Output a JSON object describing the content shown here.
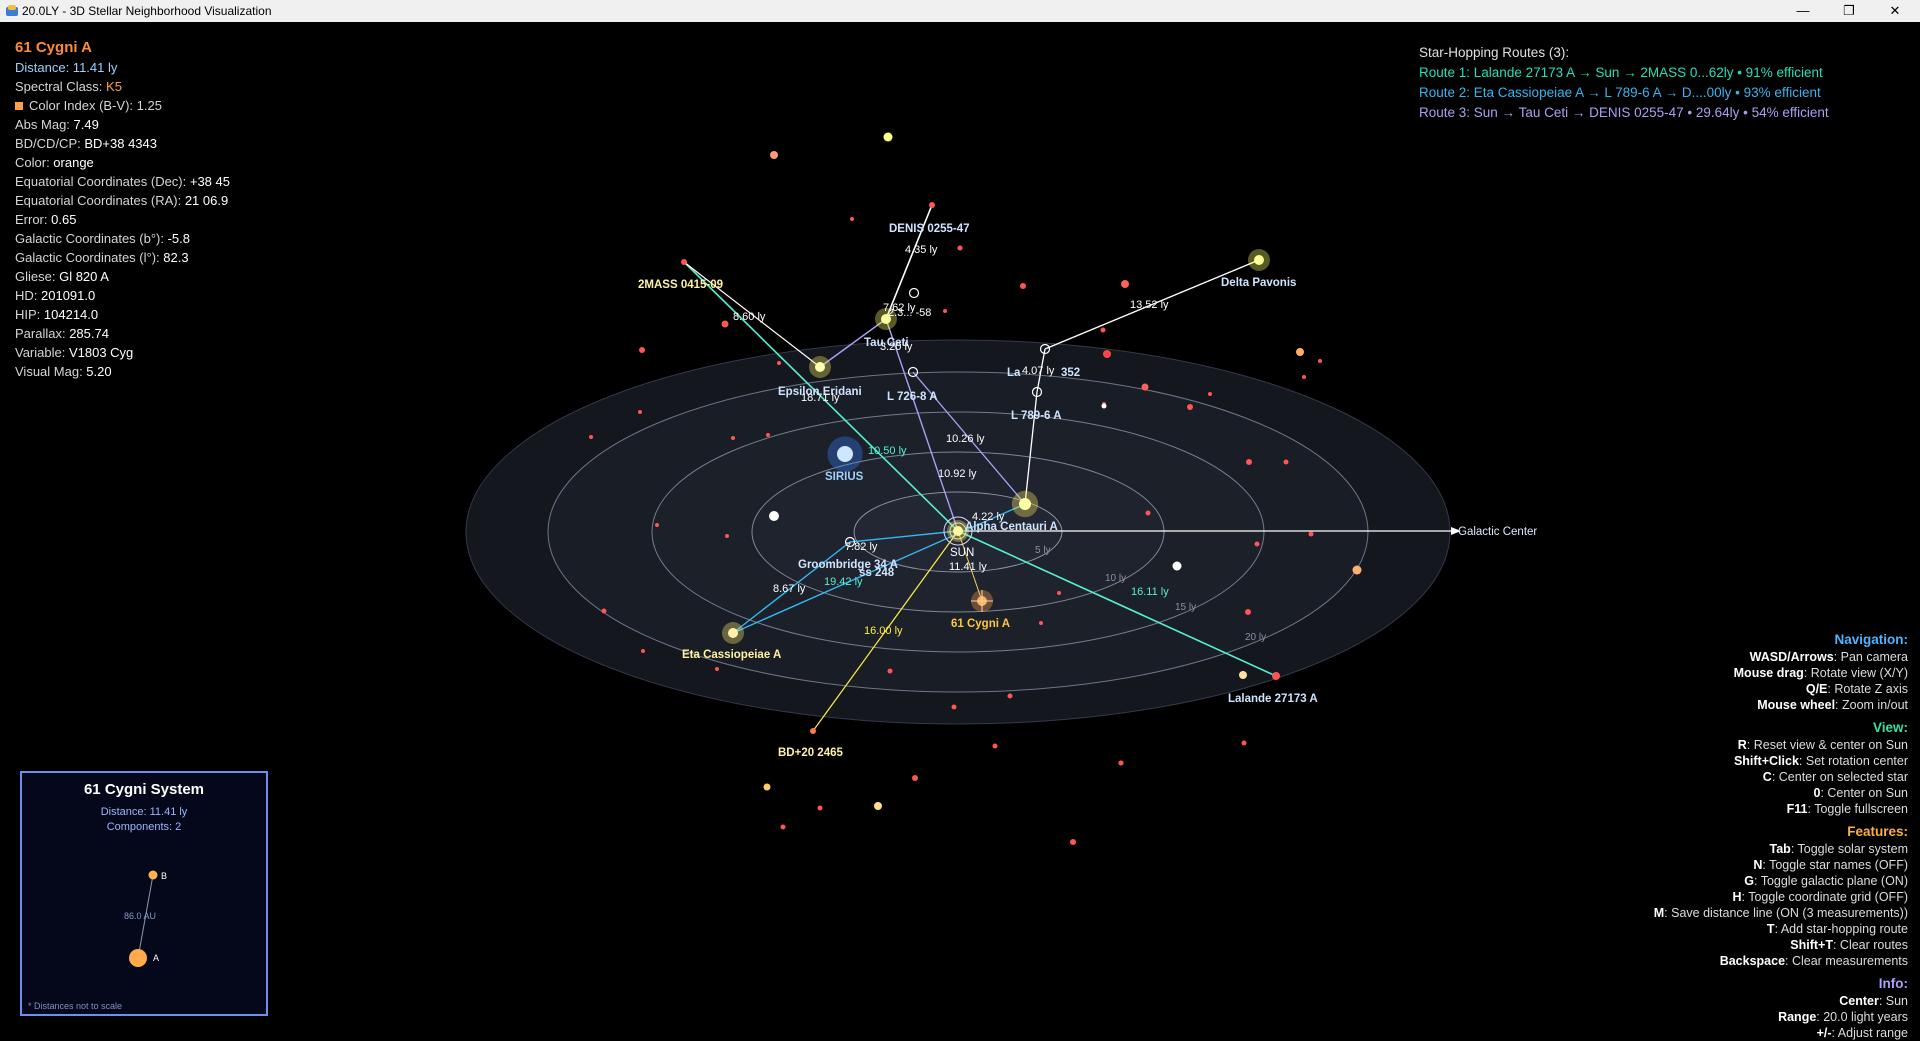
{
  "window": {
    "title": "20.0LY - 3D Stellar Neighborhood Visualization",
    "min_glyph": "—",
    "restore_glyph": "❐",
    "close_glyph": "✕",
    "icon": "app-logo-icon"
  },
  "info": {
    "name": "61 Cygni A",
    "distance": "Distance: 11.41 ly",
    "spectral_label": "Spectral Class: ",
    "spectral_value": "K5",
    "color_index": "Color Index (B-V): 1.25",
    "fields": [
      {
        "label": "Abs Mag: ",
        "value": "7.49"
      },
      {
        "label": "BD/CD/CP: ",
        "value": "BD+38 4343"
      },
      {
        "label": "Color: ",
        "value": "orange"
      },
      {
        "label": "Equatorial Coordinates (Dec): ",
        "value": "+38 45"
      },
      {
        "label": "Equatorial Coordinates (RA): ",
        "value": "21 06.9"
      },
      {
        "label": "Error: ",
        "value": "0.65"
      },
      {
        "label": "Galactic Coordinates (b°): ",
        "value": "-5.8"
      },
      {
        "label": "Galactic Coordinates (l°): ",
        "value": "82.3"
      },
      {
        "label": "Gliese: ",
        "value": "Gl 820 A"
      },
      {
        "label": "HD: ",
        "value": "201091.0"
      },
      {
        "label": "HIP: ",
        "value": "104214.0"
      },
      {
        "label": "Parallax: ",
        "value": "285.74"
      },
      {
        "label": "Variable: ",
        "value": "V1803 Cyg"
      },
      {
        "label": "Visual Mag: ",
        "value": "5.20"
      }
    ]
  },
  "routes": {
    "header": "Star-Hopping Routes (3):",
    "items": [
      {
        "text": "Route 1: Lalande 27173 A → Sun → 2MASS 0...62ly • 91% efficient",
        "color": "#22e0b8"
      },
      {
        "text": "Route 2: Eta Cassiopeiae A → L 789-6 A → D....00ly • 93% efficient",
        "color": "#35b6f0"
      },
      {
        "text": "Route 3: Sun → Tau Ceti → DENIS 0255-47 • 29.64ly • 54% efficient",
        "color": "#a9a0f5"
      }
    ]
  },
  "help": [
    {
      "title": "Navigation:",
      "color": "#4fb3ff",
      "items": [
        {
          "key": "WASD/Arrows",
          "desc": ": Pan camera"
        },
        {
          "key": "Mouse drag",
          "desc": ": Rotate view (X/Y)"
        },
        {
          "key": "Q/E",
          "desc": ": Rotate Z axis"
        },
        {
          "key": "Mouse wheel",
          "desc": ": Zoom in/out"
        }
      ]
    },
    {
      "title": "View:",
      "color": "#3de0a0",
      "items": [
        {
          "key": "R",
          "desc": ": Reset view & center on Sun"
        },
        {
          "key": "Shift+Click",
          "desc": ": Set rotation center"
        },
        {
          "key": "C",
          "desc": ": Center on selected star"
        },
        {
          "key": "0",
          "desc": ": Center on Sun"
        },
        {
          "key": "F11",
          "desc": ": Toggle fullscreen"
        }
      ]
    },
    {
      "title": "Features:",
      "color": "#ffae45",
      "items": [
        {
          "key": "Tab",
          "desc": ": Toggle solar system"
        },
        {
          "key": "N",
          "desc": ": Toggle star names (OFF)"
        },
        {
          "key": "G",
          "desc": ": Toggle galactic plane (ON)"
        },
        {
          "key": "H",
          "desc": ": Toggle coordinate grid (OFF)"
        },
        {
          "key": "M",
          "desc": ": Save distance line (ON (3 measurements))"
        },
        {
          "key": "T",
          "desc": ": Add star-hopping route"
        },
        {
          "key": "Shift+T",
          "desc": ": Clear routes"
        },
        {
          "key": "Backspace",
          "desc": ": Clear measurements"
        }
      ]
    },
    {
      "title": "Info:",
      "color": "#b39cff",
      "items": [
        {
          "key": "Center",
          "desc": ": Sun"
        },
        {
          "key": "Range",
          "desc": ": 20.0 light years"
        },
        {
          "key": "+/-",
          "desc": ": Adjust range"
        }
      ]
    }
  ],
  "system": {
    "title": "61 Cygni System",
    "distance": "Distance: 11.41 ly",
    "components": "Components: 2",
    "sep": "86.0 AU",
    "a_label": "A",
    "b_label": "B",
    "note": "* Distances not to scale"
  },
  "scene": {
    "galactic_center": "Galactic Center",
    "ring_labels": [
      "5 ly",
      "10 ly",
      "15 ly",
      "20 ly"
    ],
    "labels": [
      {
        "text": "DENIS 0255-47",
        "color": "#cfe4ff",
        "bold": true
      },
      {
        "text": "2MASS 0415-09",
        "color": "#fff2a0",
        "bold": true
      },
      {
        "text": "Delta Pavonis",
        "color": "#cfe4ff",
        "bold": true
      },
      {
        "text": "Tau Ceti",
        "color": "#cfe4ff",
        "bold": true
      },
      {
        "text": "La",
        "color": "#cfe4ff",
        "bold": true
      },
      {
        "text": "352",
        "color": "#cfe4ff",
        "bold": true
      },
      {
        "text": "Epsilon Eridani",
        "color": "#cfe4ff",
        "bold": true
      },
      {
        "text": "L 726-8 A",
        "color": "#cfe4ff",
        "bold": true
      },
      {
        "text": "L 789-6 A",
        "color": "#cfe4ff",
        "bold": true
      },
      {
        "text": "SIRIUS",
        "color": "#9fd0ff",
        "bold": true
      },
      {
        "text": "Alpha Centauri A",
        "color": "#cfe4ff",
        "bold": true
      },
      {
        "text": "SUN",
        "color": "#ffffff",
        "bold": false
      },
      {
        "text": "Groombridge 34 A",
        "color": "#cfe4ff",
        "bold": true
      },
      {
        "text": "ss 248",
        "color": "#cfe4ff",
        "bold": true
      },
      {
        "text": "61 Cygni A",
        "color": "#ffc640",
        "bold": true
      },
      {
        "text": "Eta Cassiopeiae A",
        "color": "#fff2a0",
        "bold": true
      },
      {
        "text": "Lalande 27173 A",
        "color": "#cfe4ff",
        "bold": true
      },
      {
        "text": "BD+20 2465",
        "color": "#fff2a0",
        "bold": true
      }
    ],
    "distances": [
      {
        "text": "4.35 ly",
        "color": "#ffffff"
      },
      {
        "text": "7.62 ly",
        "color": "#ffffff"
      },
      {
        "text": "2.3... -58",
        "color": "#ffffff"
      },
      {
        "text": "3.20 ly",
        "color": "#ffffff"
      },
      {
        "text": "13.52 ly",
        "color": "#ffffff"
      },
      {
        "text": "8.60 ly",
        "color": "#ffffff"
      },
      {
        "text": "18.71 ly",
        "color": "#ffffff"
      },
      {
        "text": "4.07 ly",
        "color": "#ffffff"
      },
      {
        "text": "10.26 ly",
        "color": "#ffffff"
      },
      {
        "text": "10.50 ly",
        "color": "#55f0d0"
      },
      {
        "text": "10.92 ly",
        "color": "#ffffff"
      },
      {
        "text": "4.22 ly",
        "color": "#ffffff"
      },
      {
        "text": "7.82 ly",
        "color": "#ffffff"
      },
      {
        "text": "11.41 ly",
        "color": "#ffffff"
      },
      {
        "text": "19.42 ly",
        "color": "#55f0d0"
      },
      {
        "text": "8.67 ly",
        "color": "#ffffff"
      },
      {
        "text": "16.11 ly",
        "color": "#55f0d0"
      },
      {
        "text": "16.00 ly",
        "color": "#ffee44"
      }
    ]
  }
}
